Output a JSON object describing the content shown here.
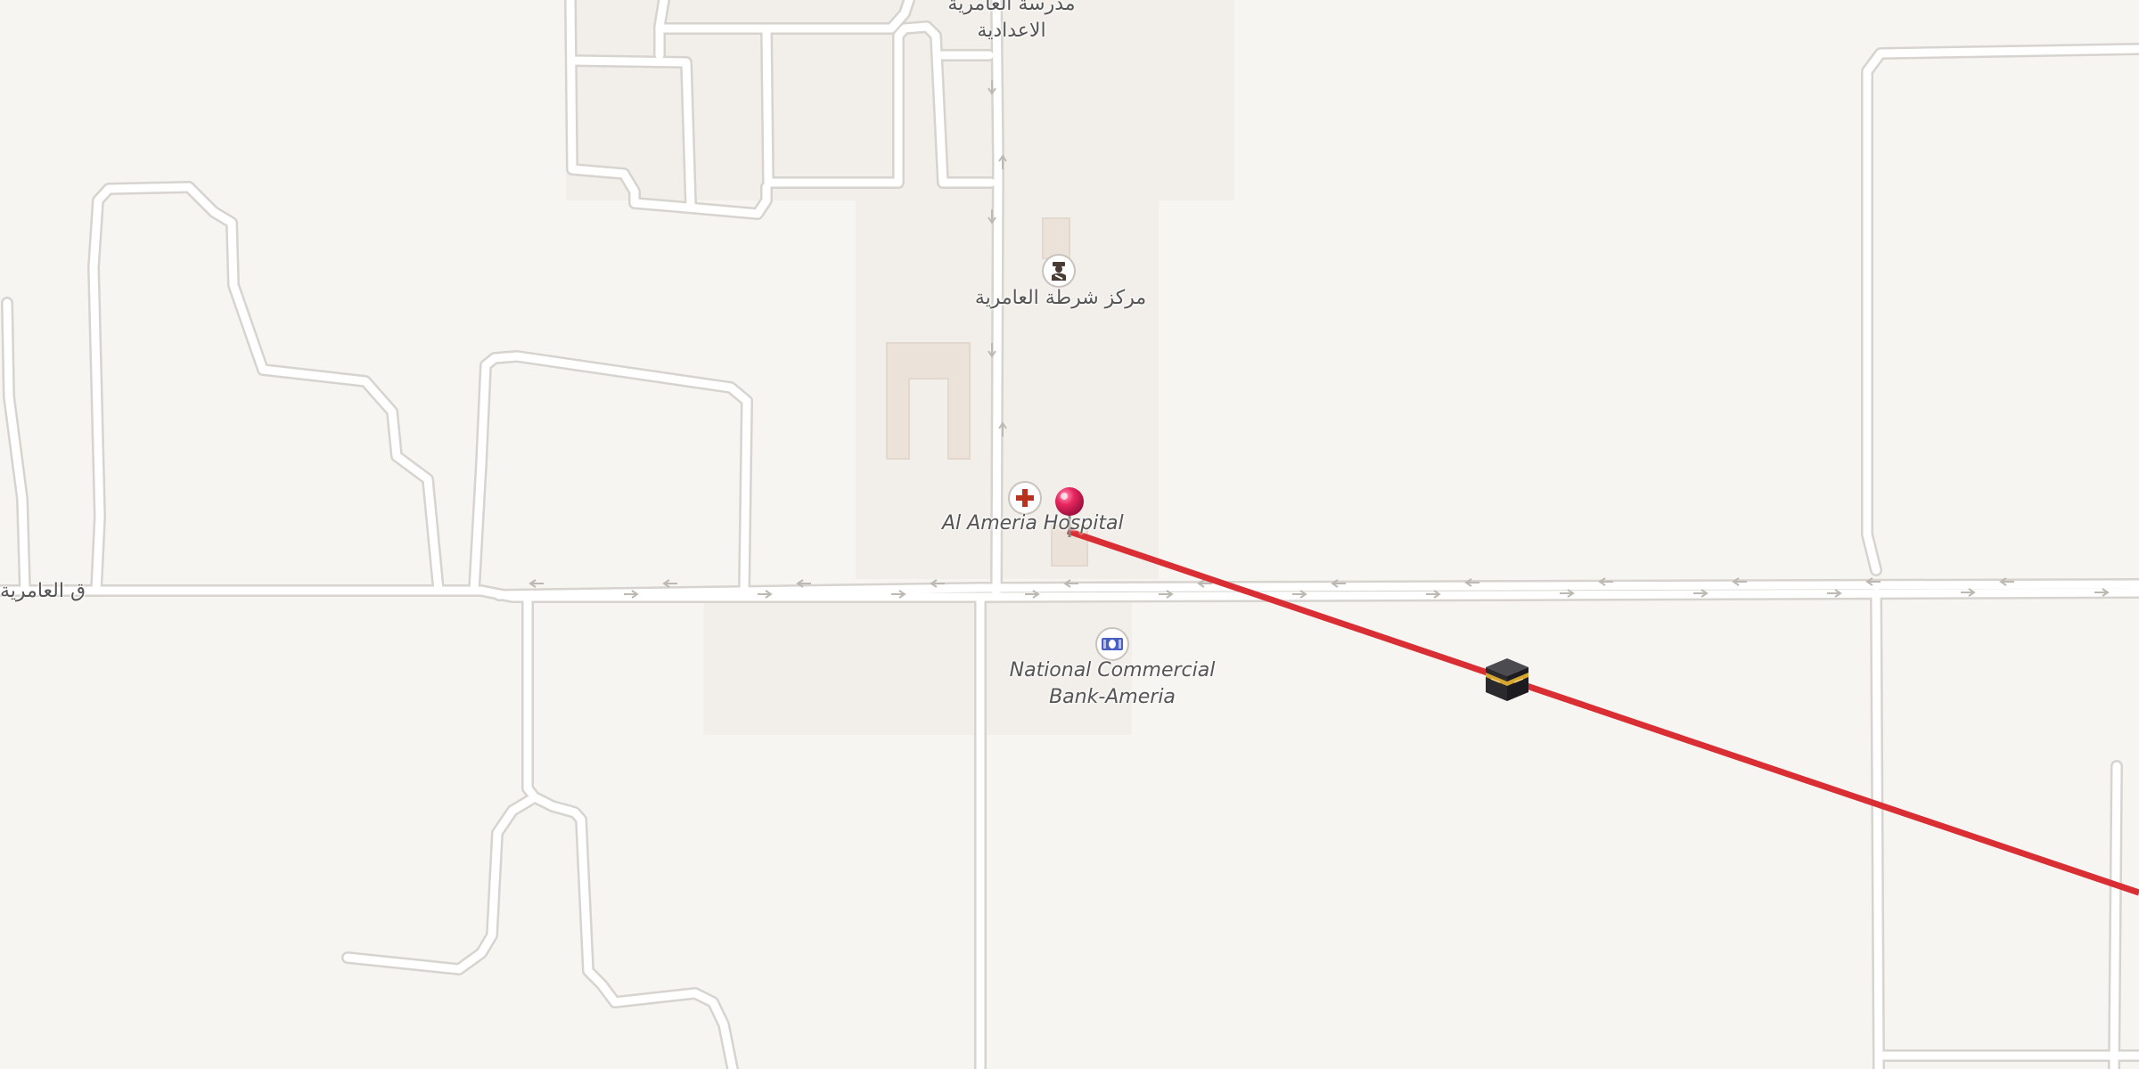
{
  "map": {
    "labels": {
      "school_line1": "مدرسة العامرية",
      "school_line2": "الاعدادية",
      "police": "مركز شرطة العامرية",
      "hospital": "Al Ameria Hospital",
      "bank_line1": "National Commercial",
      "bank_line2": "Bank-Ameria",
      "road": "ق العامرية"
    },
    "icons": {
      "hospital": "hospital-cross-icon",
      "police": "police-officer-icon",
      "bank": "banknote-icon",
      "pin": "location-pin-icon",
      "kaaba": "kaaba-icon"
    },
    "colors": {
      "background": "#f7f5f2",
      "road_fill": "#ffffff",
      "road_casing": "#d7d3ce",
      "landuse": "#f2efeb",
      "building": "#eae2da",
      "qibla_line": "#d92f34",
      "pin": "#e8265e",
      "hospital_cross": "#b8321f",
      "bank_note": "#4a5fbf"
    }
  }
}
